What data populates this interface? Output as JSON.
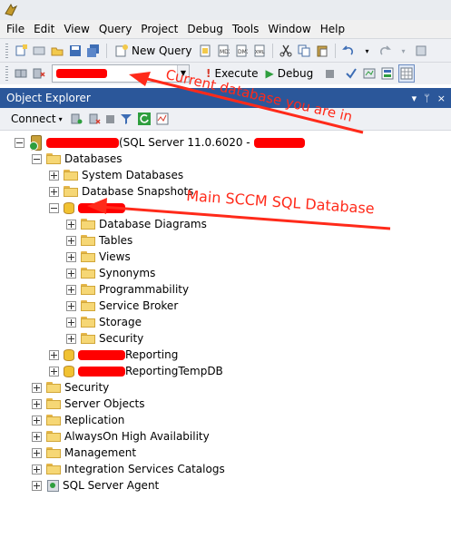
{
  "menu": [
    "File",
    "Edit",
    "View",
    "Query",
    "Project",
    "Debug",
    "Tools",
    "Window",
    "Help"
  ],
  "toolbar": {
    "new_query_label": "New Query",
    "execute_label": "Execute",
    "debug_label": "Debug"
  },
  "object_explorer": {
    "title": "Object Explorer",
    "pin_glyph": "▾ ᛘ ×",
    "connect_label": "Connect"
  },
  "tree": {
    "server_suffix": "(SQL Server 11.0.6020 -",
    "databases": "Databases",
    "system_databases": "System Databases",
    "database_snapshots": "Database Snapshots",
    "main_db_children": [
      "Database Diagrams",
      "Tables",
      "Views",
      "Synonyms",
      "Programmability",
      "Service Broker",
      "Storage",
      "Security"
    ],
    "reporting_suffix": "Reporting",
    "reporting_temp_suffix": "ReportingTempDB",
    "top_level": [
      "Security",
      "Server Objects",
      "Replication",
      "AlwaysOn High Availability",
      "Management",
      "Integration Services Catalogs"
    ],
    "sql_agent": "SQL Server Agent"
  },
  "annotations": {
    "current_db": "Current database you are in",
    "main_db": "Main SCCM SQL Database"
  },
  "colors": {
    "annotation_red": "#ff2a1a",
    "redaction_red": "#ff0000",
    "panel_title_blue": "#2b579a"
  },
  "icons": [
    "app-icon",
    "new-query-icon",
    "save-icon",
    "execute-icon",
    "debug-icon",
    "checkmark-icon",
    "folder-icon",
    "database-icon",
    "server-icon",
    "agent-icon",
    "filter-icon",
    "refresh-icon",
    "pin-icon",
    "close-icon"
  ]
}
